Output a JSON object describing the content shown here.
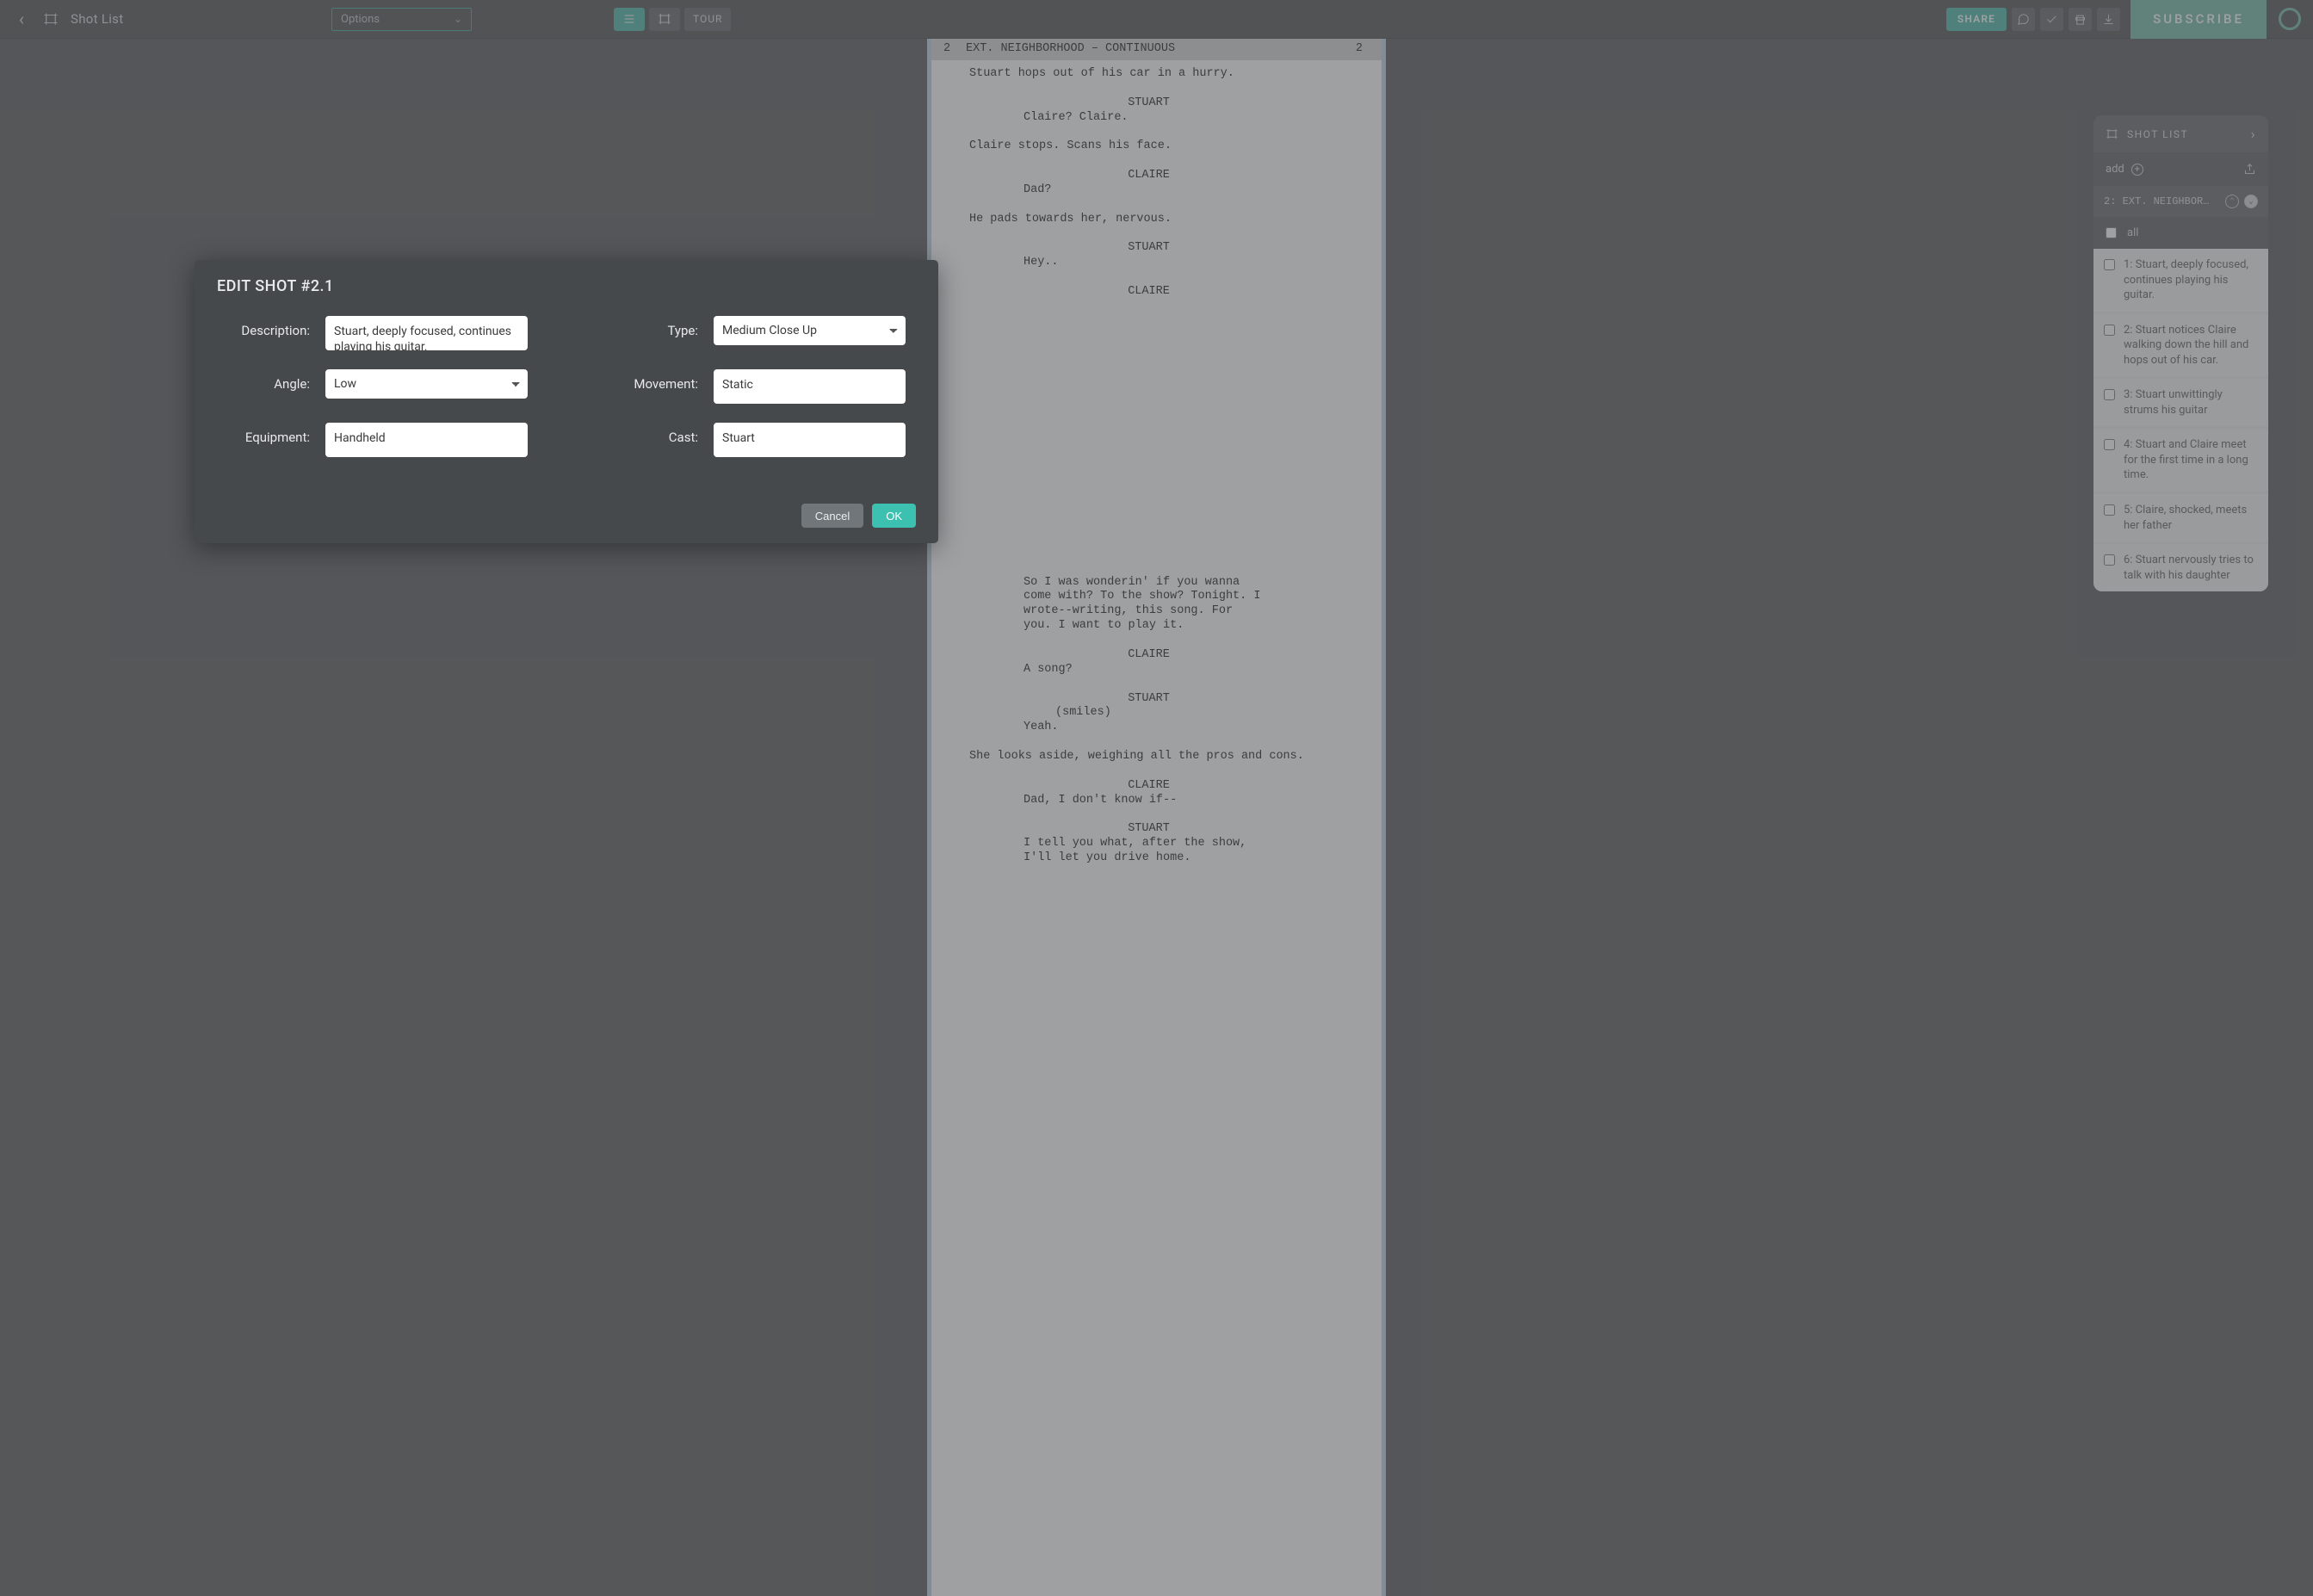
{
  "topbar": {
    "page_title": "Shot List",
    "options_label": "Options",
    "share_label": "SHARE",
    "tour_label": "TOUR",
    "subscribe_label": "SUBSCRIBE"
  },
  "script": {
    "scene_number_left": "2",
    "scene_number_right": "2",
    "slugline": "EXT. NEIGHBORHOOD – CONTINUOUS",
    "lines": [
      {
        "t": "act",
        "v": "Stuart hops out of his car in a hurry."
      },
      {
        "t": "sp",
        "v": ""
      },
      {
        "t": "char",
        "v": "STUART"
      },
      {
        "t": "dia",
        "v": "Claire? Claire."
      },
      {
        "t": "sp",
        "v": ""
      },
      {
        "t": "act",
        "v": "Claire stops. Scans his face."
      },
      {
        "t": "sp",
        "v": ""
      },
      {
        "t": "char",
        "v": "CLAIRE"
      },
      {
        "t": "dia",
        "v": "Dad?"
      },
      {
        "t": "sp",
        "v": ""
      },
      {
        "t": "act",
        "v": "He pads towards her, nervous."
      },
      {
        "t": "sp",
        "v": ""
      },
      {
        "t": "char",
        "v": "STUART"
      },
      {
        "t": "dia",
        "v": "Hey.."
      },
      {
        "t": "sp",
        "v": ""
      },
      {
        "t": "char",
        "v": "CLAIRE"
      },
      {
        "t": "sp",
        "v": ""
      },
      {
        "t": "sp",
        "v": ""
      },
      {
        "t": "sp",
        "v": ""
      },
      {
        "t": "sp",
        "v": ""
      },
      {
        "t": "sp",
        "v": ""
      },
      {
        "t": "sp",
        "v": ""
      },
      {
        "t": "sp",
        "v": ""
      },
      {
        "t": "sp",
        "v": ""
      },
      {
        "t": "sp",
        "v": ""
      },
      {
        "t": "sp",
        "v": ""
      },
      {
        "t": "sp",
        "v": ""
      },
      {
        "t": "sp",
        "v": ""
      },
      {
        "t": "sp",
        "v": ""
      },
      {
        "t": "sp",
        "v": ""
      },
      {
        "t": "sp",
        "v": ""
      },
      {
        "t": "sp",
        "v": ""
      },
      {
        "t": "sp",
        "v": ""
      },
      {
        "t": "sp",
        "v": ""
      },
      {
        "t": "sp",
        "v": ""
      },
      {
        "t": "dia",
        "v": "So I was wonderin' if you wanna"
      },
      {
        "t": "dia",
        "v": "come with? To the show? Tonight. I"
      },
      {
        "t": "dia",
        "v": "wrote--writing, this song. For"
      },
      {
        "t": "dia",
        "v": "you. I want to play it."
      },
      {
        "t": "sp",
        "v": ""
      },
      {
        "t": "char",
        "v": "CLAIRE"
      },
      {
        "t": "dia",
        "v": "A song?"
      },
      {
        "t": "sp",
        "v": ""
      },
      {
        "t": "char",
        "v": "STUART"
      },
      {
        "t": "paren",
        "v": "(smiles)"
      },
      {
        "t": "dia",
        "v": "Yeah."
      },
      {
        "t": "sp",
        "v": ""
      },
      {
        "t": "act",
        "v": "She looks aside, weighing all the pros and cons."
      },
      {
        "t": "sp",
        "v": ""
      },
      {
        "t": "char",
        "v": "CLAIRE"
      },
      {
        "t": "dia",
        "v": "Dad, I don't know if--"
      },
      {
        "t": "sp",
        "v": ""
      },
      {
        "t": "char",
        "v": "STUART"
      },
      {
        "t": "dia",
        "v": "I tell you what, after the show,"
      },
      {
        "t": "dia",
        "v": "I'll let you drive home."
      }
    ]
  },
  "side_panel": {
    "title": "SHOT LIST",
    "add_label": "add",
    "scene_label": "2: EXT. NEIGHBOR…",
    "all_label": "all",
    "items": [
      "1: Stuart, deeply focused, continues playing his guitar.",
      "2: Stuart notices Claire walking down the hill and hops out of his car.",
      "3: Stuart unwittingly strums his guitar",
      "4: Stuart and Claire meet for the first time in a long time.",
      "5: Claire, shocked, meets her father",
      "6: Stuart nervously tries to talk with his daughter"
    ]
  },
  "modal": {
    "title": "EDIT SHOT #2.1",
    "labels": {
      "description": "Description:",
      "type": "Type:",
      "angle": "Angle:",
      "movement": "Movement:",
      "equipment": "Equipment:",
      "cast": "Cast:"
    },
    "values": {
      "description": "Stuart, deeply focused, continues playing his guitar.",
      "type": "Medium Close Up",
      "angle": "Low",
      "movement": "Static",
      "equipment": "Handheld",
      "cast": "Stuart"
    },
    "buttons": {
      "cancel": "Cancel",
      "ok": "OK"
    }
  }
}
